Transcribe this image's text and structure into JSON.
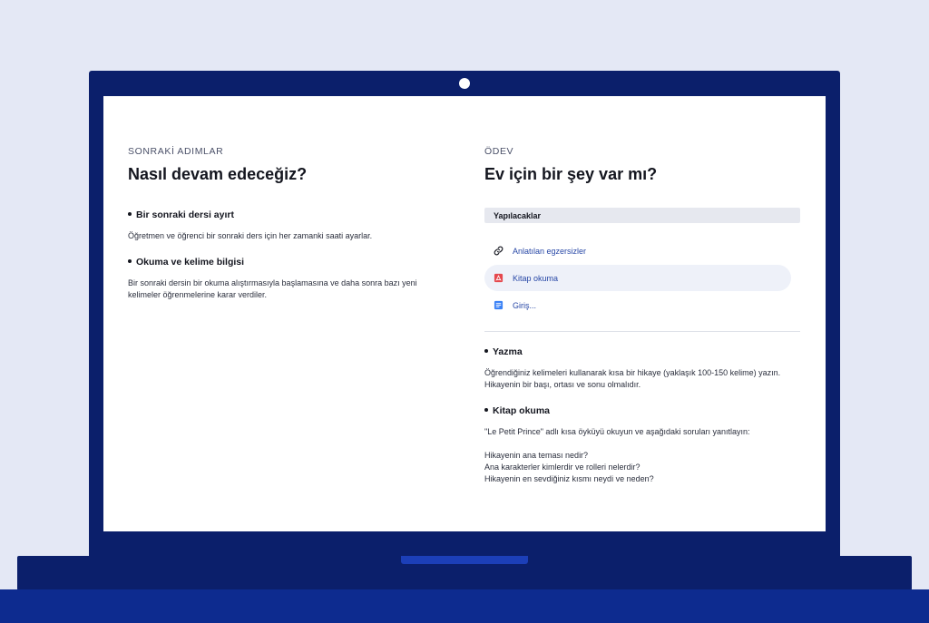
{
  "left": {
    "eyebrow": "SONRAKİ ADIMLAR",
    "heading": "Nasıl devam edeceğiz?",
    "sections": [
      {
        "title": "Bir sonraki dersi ayırt",
        "body": "Öğretmen ve öğrenci bir sonraki ders için her zamanki saati ayarlar."
      },
      {
        "title": "Okuma ve kelime bilgisi",
        "body": "Bir sonraki dersin bir okuma alıştırmasıyla başlamasına ve daha sonra bazı yeni kelimeler öğrenmelerine karar verdiler."
      }
    ]
  },
  "right": {
    "eyebrow": "ÖDEV",
    "heading": "Ev için bir şey var mı?",
    "todo_header": "Yapılacaklar",
    "todo_items": [
      {
        "label": "Anlatılan egzersizler",
        "icon": "link-icon"
      },
      {
        "label": "Kitap okuma",
        "icon": "pdf-icon"
      },
      {
        "label": "Giriş...",
        "icon": "document-icon"
      }
    ],
    "sections": [
      {
        "title": "Yazma",
        "body_lines": [
          "Öğrendiğiniz kelimeleri kullanarak kısa bir hikaye (yaklaşık 100-150 kelime) yazın.",
          "Hikayenin bir başı, ortası ve sonu olmalıdır."
        ]
      },
      {
        "title": "Kitap okuma",
        "body_lines": [
          "\"Le Petit Prince\" adlı kısa öyküyü okuyun ve aşağıdaki soruları yanıtlayın:",
          "",
          "Hikayenin ana teması nedir?",
          "Ana karakterler kimlerdir ve rolleri nelerdir?",
          "Hikayenin en sevdiğiniz kısmı neydi ve neden?"
        ]
      }
    ]
  },
  "colors": {
    "background": "#e4e8f5",
    "laptop": "#0b1f6b",
    "desk": "#0d2b8f",
    "link": "#2747a6",
    "pdf_red": "#e5484d",
    "doc_blue": "#3b82f6"
  }
}
